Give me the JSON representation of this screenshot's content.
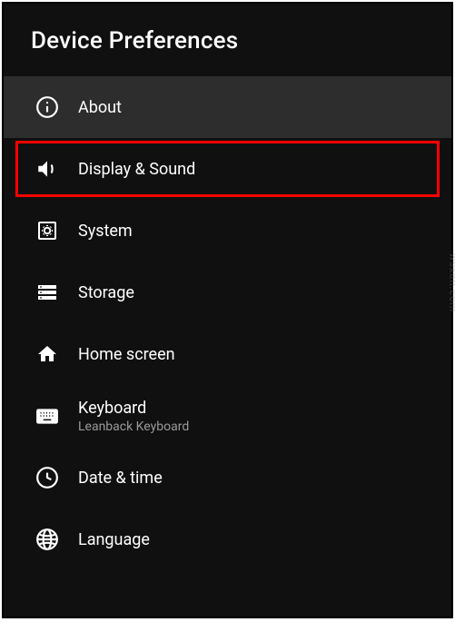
{
  "header": {
    "title": "Device Preferences"
  },
  "items": [
    {
      "label": "About",
      "icon": "info-icon",
      "selected": true,
      "highlighted": false,
      "sub": ""
    },
    {
      "label": "Display & Sound",
      "icon": "speaker-icon",
      "selected": false,
      "highlighted": true,
      "sub": ""
    },
    {
      "label": "System",
      "icon": "system-icon",
      "selected": false,
      "highlighted": false,
      "sub": ""
    },
    {
      "label": "Storage",
      "icon": "storage-icon",
      "selected": false,
      "highlighted": false,
      "sub": ""
    },
    {
      "label": "Home screen",
      "icon": "home-icon",
      "selected": false,
      "highlighted": false,
      "sub": ""
    },
    {
      "label": "Keyboard",
      "icon": "keyboard-icon",
      "selected": false,
      "highlighted": false,
      "sub": "Leanback Keyboard"
    },
    {
      "label": "Date & time",
      "icon": "clock-icon",
      "selected": false,
      "highlighted": false,
      "sub": ""
    },
    {
      "label": "Language",
      "icon": "globe-icon",
      "selected": false,
      "highlighted": false,
      "sub": ""
    }
  ],
  "watermark": "wsxdn.com"
}
